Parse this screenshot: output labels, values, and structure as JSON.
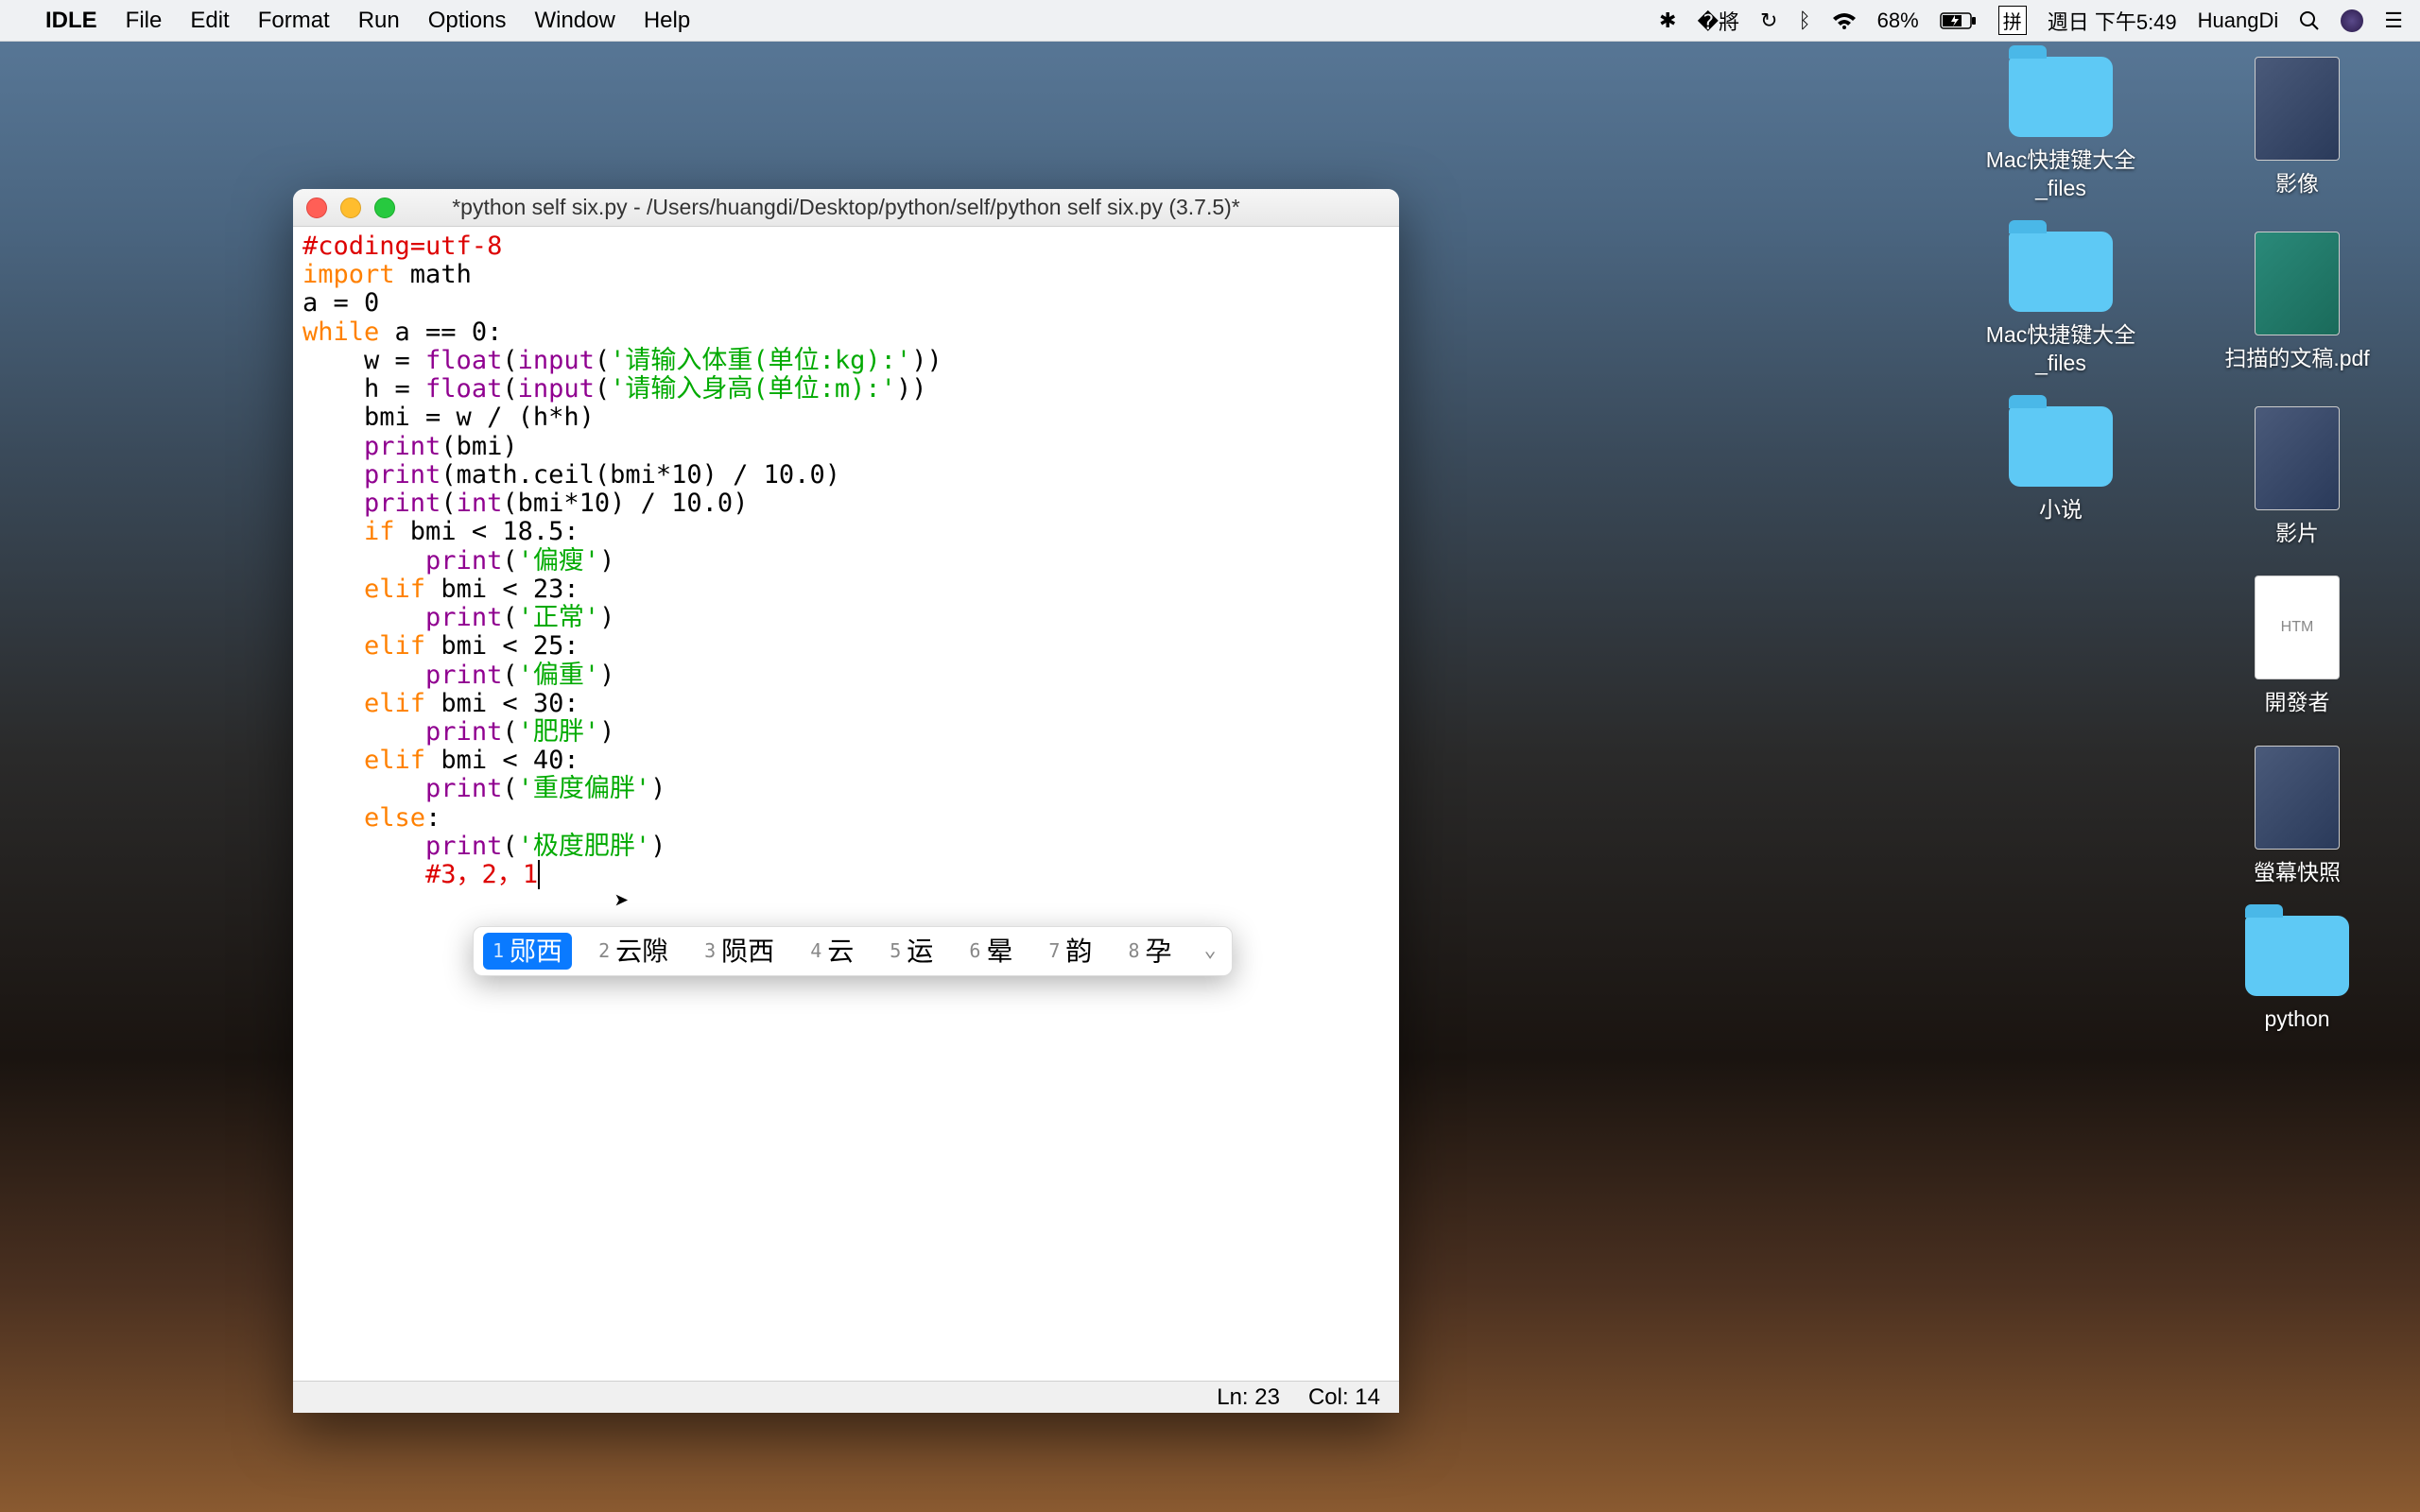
{
  "menubar": {
    "app_name": "IDLE",
    "menus": [
      "File",
      "Edit",
      "Format",
      "Run",
      "Options",
      "Window",
      "Help"
    ],
    "battery_pct": "68%",
    "ime_label": "拼",
    "date_time": "週日 下午5:49",
    "user": "HuangDi"
  },
  "desktop": {
    "icons": [
      [
        {
          "type": "folder",
          "label": "Mac快捷键大全_files"
        },
        {
          "type": "img",
          "label": "影像"
        }
      ],
      [
        {
          "type": "folder",
          "label": "Mac快捷键大全_files"
        },
        {
          "type": "pdf",
          "label": "扫描的文稿.pdf"
        }
      ],
      [
        {
          "type": "folder",
          "label": "小说"
        },
        {
          "type": "img",
          "label": "影片"
        }
      ],
      [
        {
          "type": "blank",
          "label": ""
        },
        {
          "type": "html",
          "label": "開發者",
          "text": "HTM"
        }
      ],
      [
        {
          "type": "blank",
          "label": ""
        },
        {
          "type": "img",
          "label": "螢幕快照"
        }
      ],
      [
        {
          "type": "blank",
          "label": ""
        },
        {
          "type": "folder",
          "label": "python"
        }
      ]
    ]
  },
  "editor": {
    "title": "*python self six.py - /Users/huangdi/Desktop/python/self/python self six.py (3.7.5)*",
    "status_line": "Ln: 23",
    "status_col": "Col: 14",
    "code_lines": {
      "l1_comment": "#coding=utf-8",
      "l2_kw": "import",
      "l2_rest": " math",
      "l3": "a = 0",
      "l4_kw": "while",
      "l4_rest": " a == 0:",
      "l5_a": "    w = ",
      "l5_fn": "float",
      "l5_b": "(",
      "l5_fn2": "input",
      "l5_c": "(",
      "l5_str": "'请输入体重(单位:kg):'",
      "l5_d": "))",
      "l6_a": "    h = ",
      "l6_fn": "float",
      "l6_b": "(",
      "l6_fn2": "input",
      "l6_c": "(",
      "l6_str": "'请输入身高(单位:m):'",
      "l6_d": "))",
      "l7": "    bmi = w / (h*h)",
      "l8_a": "    ",
      "l8_fn": "print",
      "l8_b": "(bmi)",
      "l9_a": "    ",
      "l9_fn": "print",
      "l9_b": "(math.ceil(bmi*10) / 10.0)",
      "l10_a": "    ",
      "l10_fn": "print",
      "l10_b": "(",
      "l10_fn2": "int",
      "l10_c": "(bmi*10) / 10.0)",
      "l11_a": "    ",
      "l11_kw": "if",
      "l11_b": " bmi < 18.5:",
      "l12_a": "        ",
      "l12_fn": "print",
      "l12_b": "(",
      "l12_str": "'偏瘦'",
      "l12_c": ")",
      "l13_a": "    ",
      "l13_kw": "elif",
      "l13_b": " bmi < 23:",
      "l14_a": "        ",
      "l14_fn": "print",
      "l14_b": "(",
      "l14_str": "'正常'",
      "l14_c": ")",
      "l15_a": "    ",
      "l15_kw": "elif",
      "l15_b": " bmi < 25:",
      "l16_a": "        ",
      "l16_fn": "print",
      "l16_b": "(",
      "l16_str": "'偏重'",
      "l16_c": ")",
      "l17_a": "    ",
      "l17_kw": "elif",
      "l17_b": " bmi < 30:",
      "l18_a": "        ",
      "l18_fn": "print",
      "l18_b": "(",
      "l18_str": "'肥胖'",
      "l18_c": ")",
      "l19_a": "    ",
      "l19_kw": "elif",
      "l19_b": " bmi < 40:",
      "l20_a": "        ",
      "l20_fn": "print",
      "l20_b": "(",
      "l20_str": "'重度偏胖'",
      "l20_c": ")",
      "l21_a": "    ",
      "l21_kw": "else",
      "l21_b": ":",
      "l22_a": "        ",
      "l22_fn": "print",
      "l22_b": "(",
      "l22_str": "'极度肥胖'",
      "l22_c": ")",
      "l23_a": "        ",
      "l23_cm": "#3，2，1"
    }
  },
  "ime": {
    "candidates": [
      {
        "n": "1",
        "t": "郧西"
      },
      {
        "n": "2",
        "t": "云隙"
      },
      {
        "n": "3",
        "t": "陨西"
      },
      {
        "n": "4",
        "t": "云"
      },
      {
        "n": "5",
        "t": "运"
      },
      {
        "n": "6",
        "t": "晕"
      },
      {
        "n": "7",
        "t": "韵"
      },
      {
        "n": "8",
        "t": "孕"
      }
    ]
  }
}
